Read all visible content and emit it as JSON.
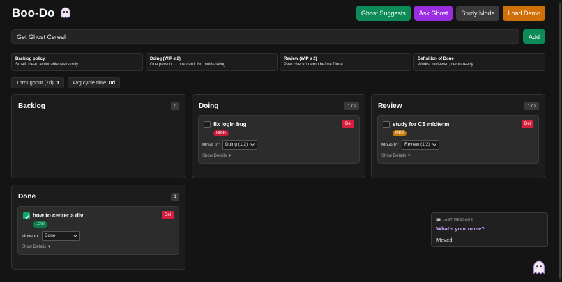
{
  "app": {
    "title": "Boo-Do"
  },
  "actions": {
    "ghost_suggests": "Ghost Suggests",
    "ask_ghost": "Ask Ghost",
    "study_mode": "Study Mode",
    "load_demo": "Load Demo"
  },
  "new_task": {
    "value": "Get Ghost Cereal",
    "add_label": "Add"
  },
  "policies": [
    {
      "title": "Backlog policy",
      "text": "Small, clear, actionable tasks only."
    },
    {
      "title": "Doing (WIP ≤ 2)",
      "text": "One person → one card. No multitasking."
    },
    {
      "title": "Review (WIP ≤ 2)",
      "text": "Peer check / demo before Done."
    },
    {
      "title": "Definition of Done",
      "text": "Works, reviewed, demo-ready."
    }
  ],
  "metrics": {
    "throughput_label": "Throughput (7d):",
    "throughput_value": "1",
    "cycle_label": "Avg cycle time:",
    "cycle_value": "0d"
  },
  "columns": {
    "backlog": {
      "title": "Backlog",
      "count": "0"
    },
    "doing": {
      "title": "Doing",
      "count": "1 / 2"
    },
    "review": {
      "title": "Review",
      "count": "1 / 2"
    },
    "done": {
      "title": "Done",
      "count": "1"
    }
  },
  "cards": {
    "doing": {
      "title": "fix login bug",
      "priority": "HIGH",
      "move_label": "Move to:",
      "move_value": "Doing (1/2)",
      "details": "Show Details ▼",
      "delete": "Del",
      "done": false
    },
    "review": {
      "title": "study for CS midterm",
      "priority": "MED",
      "move_label": "Move to:",
      "move_value": "Review (1/2)",
      "details": "Show Details ▼",
      "delete": "Del",
      "done": false
    },
    "done": {
      "title": "how to center a div",
      "priority": "LOW",
      "move_label": "Move to:",
      "move_value": "Done",
      "details": "Show Details ▼",
      "delete": "Del",
      "done": true
    }
  },
  "last_message": {
    "label": "LAST MESSAGE",
    "question": "What's your name?",
    "answer": "Moved."
  },
  "colors": {
    "accent_green": "#0c8a57",
    "accent_purple": "#9b2de0",
    "accent_orange": "#d07008",
    "danger": "#d61f3f"
  },
  "icons": [
    "ghost-icon",
    "chat-icon",
    "check-icon",
    "chevron-down-icon"
  ]
}
